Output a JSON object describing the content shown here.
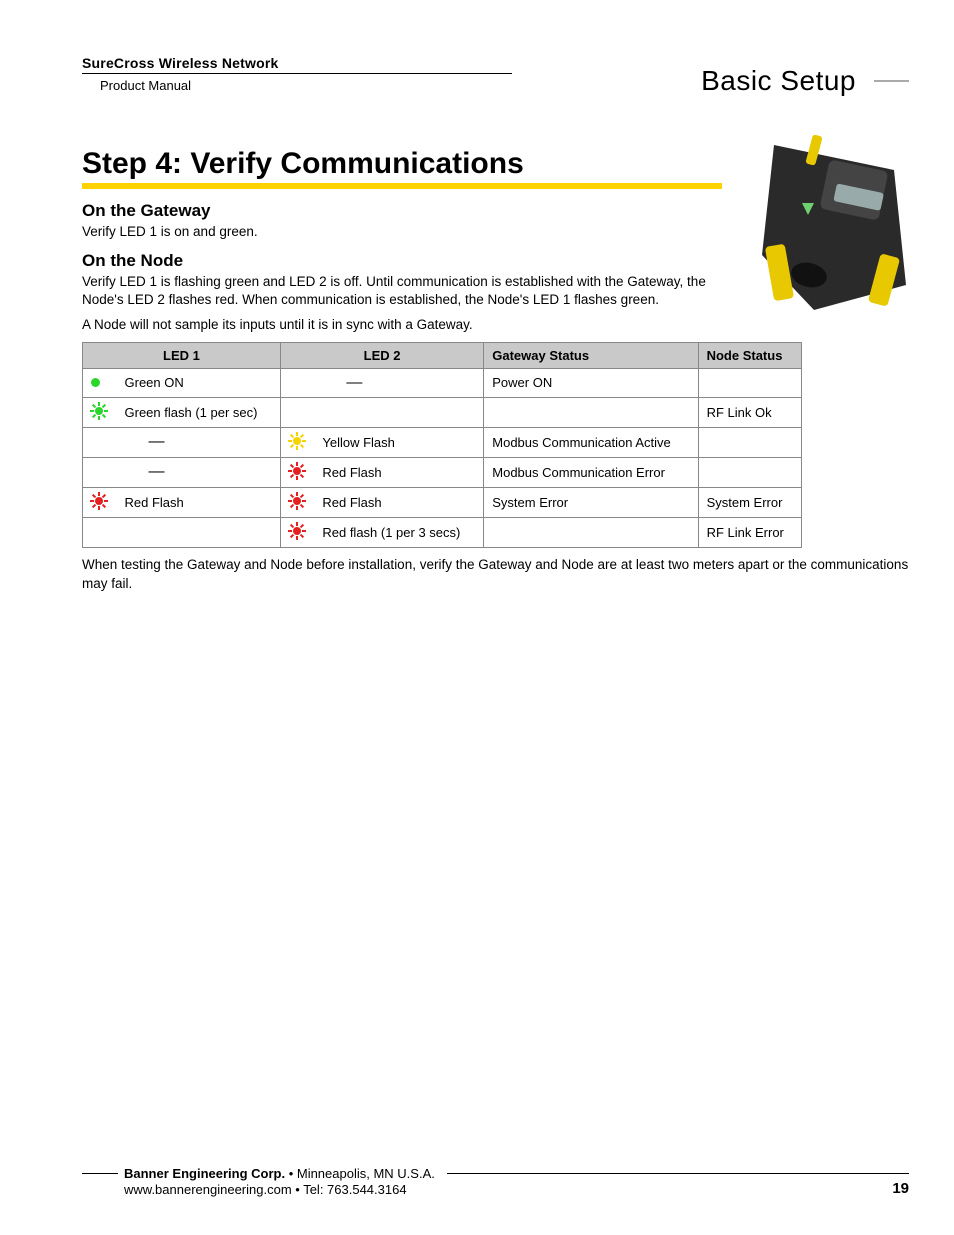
{
  "header": {
    "product_line": "SureCross Wireless Network",
    "doc_type": "Product Manual",
    "section": "Basic Setup"
  },
  "title": "Step 4: Verify Communications",
  "gateway": {
    "heading": "On the Gateway",
    "text": "Verify LED 1 is on and green."
  },
  "node": {
    "heading": "On the Node",
    "text1": "Verify LED 1 is flashing green and LED 2 is off. Until communication is established with the Gateway, the Node's LED 2 flashes red. When communication is established, the Node's LED 1 flashes green.",
    "text2": "A Node will not sample its inputs until it is in sync with a Gateway."
  },
  "table": {
    "headers": {
      "led1": "LED 1",
      "led2": "LED 2",
      "gw": "Gateway Status",
      "node": "Node Status"
    },
    "rows": [
      {
        "led1_icon": "dot-green",
        "led1_text": "Green ON",
        "led2_icon": "",
        "led2_text": "—",
        "gw": "Power ON",
        "node": ""
      },
      {
        "led1_icon": "flash-green",
        "led1_text": "Green flash (1 per sec)",
        "led2_icon": "",
        "led2_text": "",
        "gw": "",
        "node": "RF Link Ok"
      },
      {
        "led1_icon": "",
        "led1_text": "—",
        "led2_icon": "flash-yellow",
        "led2_text": "Yellow Flash",
        "gw": "Modbus Communication Active",
        "node": ""
      },
      {
        "led1_icon": "",
        "led1_text": "—",
        "led2_icon": "flash-red",
        "led2_text": "Red Flash",
        "gw": "Modbus Communication Error",
        "node": ""
      },
      {
        "led1_icon": "flash-red",
        "led1_text": "Red Flash",
        "led2_icon": "flash-red",
        "led2_text": "Red Flash",
        "gw": "System Error",
        "node": "System Error"
      },
      {
        "led1_icon": "",
        "led1_text": "",
        "led2_icon": "flash-red",
        "led2_text": "Red flash (1 per 3 secs)",
        "gw": "",
        "node": "RF Link Error"
      }
    ]
  },
  "note": "When testing the Gateway and Node before installation, verify the Gateway and Node are at least two meters apart or the communications may fail.",
  "footer": {
    "company": "Banner Engineering Corp.",
    "sep": " • ",
    "loc": "Minneapolis, MN U.S.A.",
    "web": "www.bannerengineering.com",
    "tel": "Tel: 763.544.3164",
    "page": "19"
  }
}
